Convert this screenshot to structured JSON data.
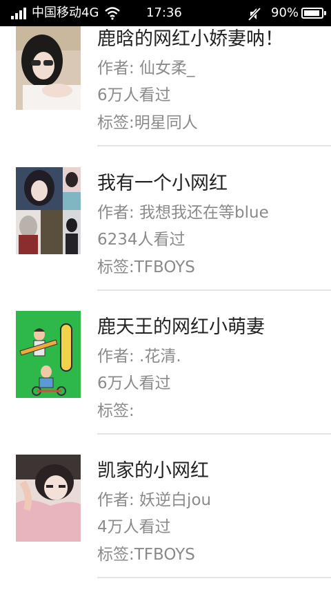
{
  "status_bar": {
    "carrier": "中国移动4G",
    "time": "17:36",
    "battery_percent": "90%",
    "battery_level": 0.9,
    "signal_icon": "signal-bars-icon",
    "wifi_icon": "wifi-icon",
    "mute_icon": "mute-icon",
    "battery_icon": "battery-icon"
  },
  "books": [
    {
      "title": "鹿晗的网红小娇妻呐！",
      "author": "作者: 仙女柔_",
      "views": "6万人看过",
      "tags": "标签:明星同人",
      "cover": "cover-girl-portrait"
    },
    {
      "title": "我有一个小网红",
      "author": "作者: 我想我还在等blue",
      "views": "6234人看过",
      "tags": "标签:TFBOYS",
      "cover": "cover-photo-collage"
    },
    {
      "title": "鹿天王的网红小萌妻",
      "author": "作者: .花清.",
      "views": "6万人看过",
      "tags": "标签:",
      "cover": "cover-cheese-illustration"
    },
    {
      "title": "凯家的小网红",
      "author": "作者: 妖逆白jou",
      "views": "4万人看过",
      "tags": "标签:TFBOYS",
      "cover": "cover-girl-hoodie"
    }
  ],
  "colors": {
    "status_bar_bg": "#000000",
    "title_text": "#222222",
    "meta_text": "#8a8a8a",
    "divider": "#e4e4e4",
    "cover3_bg": "#2eb84a"
  }
}
